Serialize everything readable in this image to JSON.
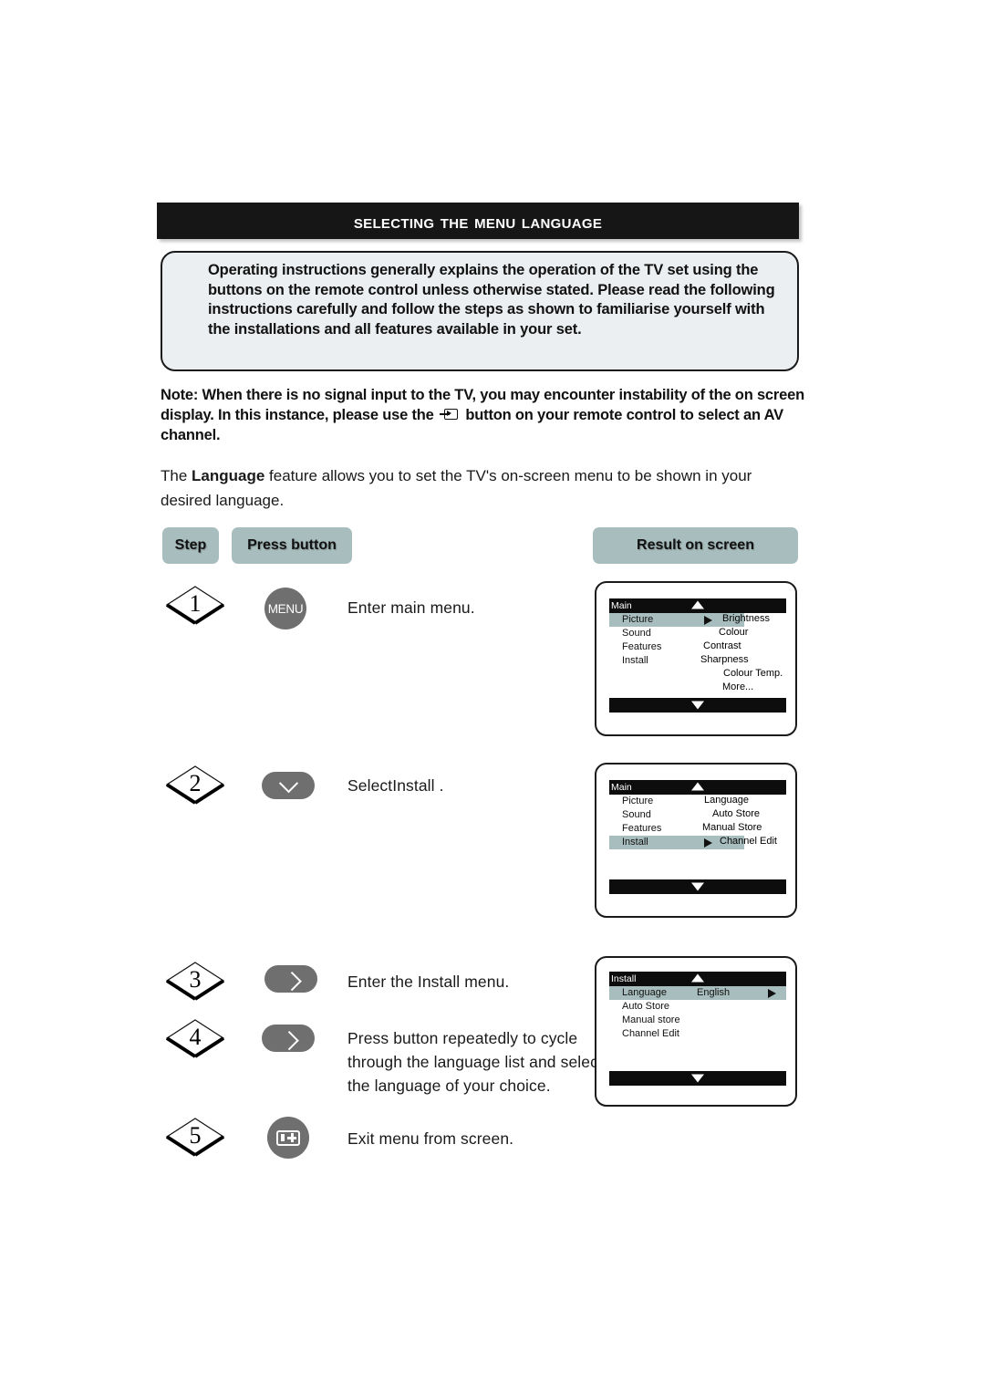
{
  "title": "Selecting the Menu Language",
  "intro": "Operating instructions generally explains the operation of the TV set using the buttons on the remote control unless otherwise stated. Please read the following instructions carefully and follow the steps as shown to familiarise yourself with the installations and all features available in your set.",
  "note": {
    "part1": "Note: When there is no signal input to the TV, you may encounter instability of the on screen display. In this instance, please use the",
    "icon": "av-input-icon",
    "part2": "button on your remote control to select an AV channel."
  },
  "language_paragraph": {
    "before": "The ",
    "bold": "Language",
    "after": " feature allows you to set the TV's on-screen menu to be shown in your desired language."
  },
  "table_headers": {
    "step": "Step",
    "press_button": "Press button",
    "result": "Result on screen"
  },
  "steps": [
    {
      "number": "1",
      "button_type": "round-menu",
      "button_label": "MENU",
      "description": "Enter main menu."
    },
    {
      "number": "2",
      "button_type": "pill-down",
      "button_label": "down-chevron-icon",
      "description": "SelectInstall ."
    },
    {
      "number": "3",
      "button_type": "pill-right",
      "button_label": "right-chevron-icon",
      "description": "Enter the Install menu."
    },
    {
      "number": "4",
      "button_type": "pill-right",
      "button_label": "right-chevron-icon",
      "description": "Press button repeatedly to cycle through the language list and select the language of your choice."
    },
    {
      "number": "5",
      "button_type": "round-av",
      "button_label": "av-exit-icon",
      "description": "Exit menu from screen."
    }
  ],
  "screens": [
    {
      "header": "Main",
      "rows": [
        {
          "left": "Picture",
          "right": "Brightness",
          "highlighted": true,
          "arrow": true
        },
        {
          "left": "Sound",
          "right": "Colour",
          "highlighted": false,
          "arrow": false
        },
        {
          "left": "Features",
          "right": "Contrast",
          "highlighted": false,
          "arrow": false
        },
        {
          "left": "Install",
          "right": "Sharpness",
          "highlighted": false,
          "arrow": false
        },
        {
          "left": "",
          "right": "Colour Temp.",
          "highlighted": false,
          "arrow": false
        },
        {
          "left": "",
          "right": "More...",
          "highlighted": false,
          "arrow": false
        }
      ]
    },
    {
      "header": "Main",
      "rows": [
        {
          "left": "Picture",
          "right": "Language",
          "highlighted": false,
          "arrow": false
        },
        {
          "left": "Sound",
          "right": "Auto Store",
          "highlighted": false,
          "arrow": false
        },
        {
          "left": "Features",
          "right": "Manual Store",
          "highlighted": false,
          "arrow": false
        },
        {
          "left": "Install",
          "right": "Channel Edit",
          "highlighted": true,
          "arrow": true
        }
      ]
    },
    {
      "header": "Install",
      "rows": [
        {
          "left": "Language",
          "right": "English",
          "highlighted": true,
          "arrow": true
        },
        {
          "left": "Auto Store",
          "right": "",
          "highlighted": false,
          "arrow": false
        },
        {
          "left": "Manual store",
          "right": "",
          "highlighted": false,
          "arrow": false
        },
        {
          "left": "Channel Edit",
          "right": "",
          "highlighted": false,
          "arrow": false
        }
      ]
    }
  ],
  "colors": {
    "title_bar": "#161616",
    "pill": "#a8bdbd",
    "intro_box": "#eceff1",
    "button_gray": "#6f6f6f",
    "osd_bar": "#0d0d0d",
    "osd_highlight": "#a8bdbd"
  }
}
